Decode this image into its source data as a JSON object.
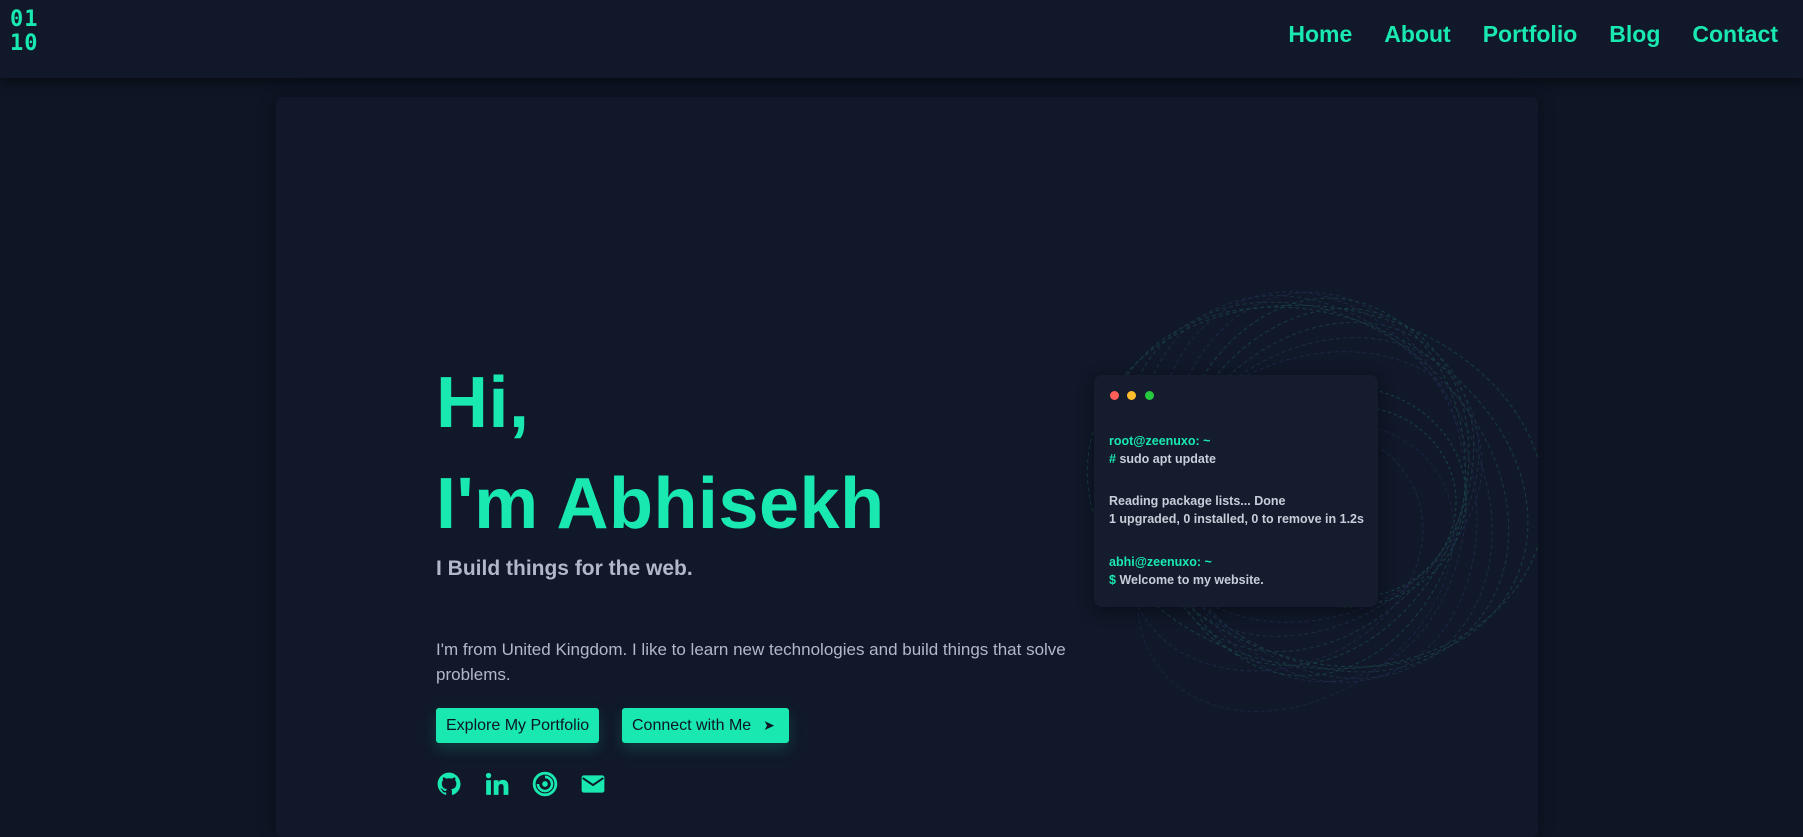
{
  "brand": {
    "logo_line1": "01",
    "logo_line2": "10"
  },
  "nav": {
    "items": [
      {
        "label": "Home"
      },
      {
        "label": "About"
      },
      {
        "label": "Portfolio"
      },
      {
        "label": "Blog"
      },
      {
        "label": "Contact"
      }
    ]
  },
  "hero": {
    "greeting_line1": "Hi,",
    "greeting_line2": "I'm Abhisekh",
    "tagline": "I Build things for the web.",
    "bio": "I'm from United Kingdom. I like to learn new technologies and build things that solve problems.",
    "primary_button": "Explore My Portfolio",
    "secondary_button": "Connect with Me",
    "secondary_button_icon": "➤"
  },
  "socials": [
    {
      "icon": "github-icon"
    },
    {
      "icon": "linkedin-icon"
    },
    {
      "icon": "blog-swirl-icon"
    },
    {
      "icon": "email-icon"
    }
  ],
  "terminal": {
    "prompt1": "root@zeenuxo: ~",
    "cmd1_symbol": "#",
    "cmd1": "sudo apt update",
    "out1": "Reading package lists... Done",
    "out2": "1 upgraded, 0 installed, 0 to remove in 1.2s",
    "prompt2": "abhi@zeenuxo: ~",
    "cmd2_symbol": "$",
    "cmd2": "Welcome to my website."
  },
  "colors": {
    "accent": "#19e8b1",
    "background": "#0e1524",
    "card": "#101829",
    "text_muted": "#b2b8cc"
  }
}
